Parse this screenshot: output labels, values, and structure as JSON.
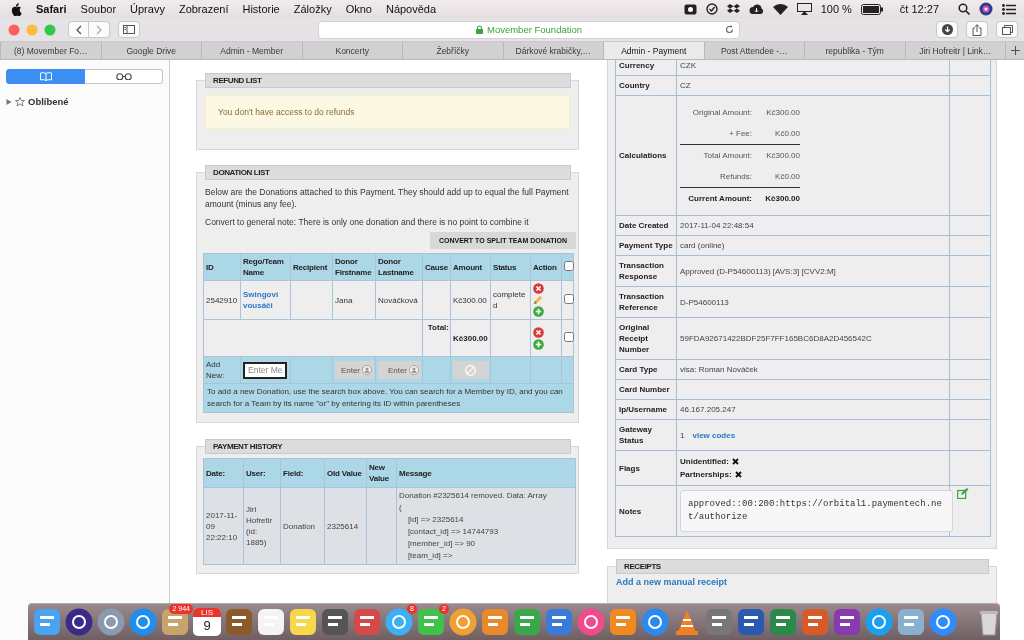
{
  "menu_bar": {
    "app_name": "Safari",
    "menus": [
      "Soubor",
      "Úpravy",
      "Zobrazení",
      "Historie",
      "Záložky",
      "Okno",
      "Nápověda"
    ],
    "battery": "100 %",
    "clock": "čt 12:27"
  },
  "address_bar": {
    "site": "Movember Foundation",
    "secure": true
  },
  "tabs": [
    {
      "label": "(8) Movember Fo…",
      "selected": false
    },
    {
      "label": "Google Drive",
      "selected": false
    },
    {
      "label": "Admin - Member",
      "selected": false
    },
    {
      "label": "Koncerty",
      "selected": false
    },
    {
      "label": "Žebříčky",
      "selected": false
    },
    {
      "label": "Dárkové krabičky,…",
      "selected": false
    },
    {
      "label": "Admin - Payment",
      "selected": true
    },
    {
      "label": "Post Attendee -…",
      "selected": false
    },
    {
      "label": "republika - Tým",
      "selected": false
    },
    {
      "label": "Jiri Hofreitr | Link…",
      "selected": false
    }
  ],
  "sidebar": {
    "view_modes": [
      {
        "selected": true
      },
      {
        "selected": false
      }
    ],
    "items": [
      {
        "label": "Oblíbené",
        "expanded": false
      }
    ]
  },
  "refund_list": {
    "title": "REFUND LIST",
    "message": "You don't have access to do refunds"
  },
  "donation_list": {
    "title": "DONATION LIST",
    "intro": "Below are the Donations attached to this Payment. They should add up to equal the full Payment amount (minus any fee).",
    "note": "Convert to general note: There is only one donation and there is no point to combine it",
    "convert_button": "CONVERT TO SPLIT TEAM DONATION",
    "columns": [
      "ID",
      "Rego/Team Name",
      "Recipient",
      "Donor Firstname",
      "Donor Lastname",
      "Cause",
      "Amount",
      "Status",
      "Action"
    ],
    "select_all_checked": false,
    "rows": [
      {
        "id": "2542910",
        "team_name": "Swingoví vousáči",
        "donor_firstname": "Jana",
        "donor_lastname": "Nováčková",
        "amount": "Kč300.00",
        "status": "completed",
        "checked": false
      }
    ],
    "total": {
      "label": "Total:",
      "amount": "Kč300.00",
      "checked": false
    },
    "add_new": {
      "label": "Add New:",
      "fields": [
        {
          "kind": "search",
          "placeholder": "Enter Me",
          "disabled": false
        },
        {
          "kind": "firstname",
          "placeholder": "Enter",
          "disabled": true
        },
        {
          "kind": "lastname",
          "placeholder": "Enter",
          "disabled": true
        },
        {
          "kind": "amount",
          "disabled": true
        }
      ]
    },
    "help": "To add a new Donation, use the search box above. You can search for a Member by ID, and you can search for a Team by its name \"or\" by entering its ID within parentheses"
  },
  "payment_history": {
    "title": "PAYMENT HISTORY",
    "columns": [
      "Date:",
      "User:",
      "Field:",
      "Old Value",
      "New Value",
      "Message"
    ],
    "rows": [
      {
        "date": "2017-11-09 22:22:10",
        "user": "Jiri Hofretir (id: 1885)",
        "field": "Donation",
        "old_value": "2325614",
        "message": "Donation #2325614 removed. Data: Array\n(\n    [id] => 2325614\n    [contact_id] => 14744793\n    [member_id] => 90\n    [team_id] =>"
      }
    ]
  },
  "payment_details": [
    {
      "label": "Currency",
      "kind": "text",
      "value": "CZK"
    },
    {
      "label": "Country",
      "kind": "text",
      "value": "CZ"
    },
    {
      "label": "Calculations",
      "kind": "calculations",
      "lines": [
        {
          "label": "Original Amount:",
          "value": "Kč300.00",
          "kind": "item"
        },
        {
          "label": "+ Fee:",
          "value": "Kč0.00",
          "kind": "item"
        },
        {
          "label": "Total Amount:",
          "value": "Kč300.00",
          "kind": "subtotal"
        },
        {
          "label": "Refunds:",
          "value": "Kč0.00",
          "kind": "item"
        },
        {
          "label": "Current Amount:",
          "value": "Kč300.00",
          "kind": "total"
        }
      ]
    },
    {
      "label": "Date Created",
      "kind": "text",
      "value": "2017-11-04 22:48:54"
    },
    {
      "label": "Payment Type",
      "kind": "text",
      "value": "card (online)"
    },
    {
      "label": "Transaction Response",
      "kind": "text",
      "value": "Approved (D-P54600113) [AVS:3] [CVV2:M]"
    },
    {
      "label": "Transaction Reference",
      "kind": "text",
      "value": "D-P54600113"
    },
    {
      "label": "Original Receipt Number",
      "kind": "text",
      "value": "59FDA92671422BDF25F7FF165BC6D8A2D456542C"
    },
    {
      "label": "Card Type",
      "kind": "text",
      "value": "visa: Roman Nováček"
    },
    {
      "label": "Card Number",
      "kind": "text"
    },
    {
      "label": "Ip/Username",
      "kind": "text",
      "value": "46.167.205.247"
    },
    {
      "label": "Gateway Status",
      "kind": "gateway",
      "value": "1",
      "link": "view codes"
    },
    {
      "label": "Flags",
      "kind": "flags",
      "flags": [
        {
          "label": "Unidentified:",
          "set": false
        },
        {
          "label": "Partnerships:",
          "set": false
        }
      ]
    },
    {
      "label": "Notes",
      "kind": "notes",
      "value": "approved::00:200:https://orbital1.paymentech.net/authorize"
    }
  ],
  "receipts": {
    "title": "RECEIPTS",
    "link": "Add a new manual receipt"
  },
  "dock": {
    "calendar": {
      "month": "LIS",
      "day": "9"
    },
    "badges": [
      "2 944",
      "8",
      "2"
    ]
  }
}
